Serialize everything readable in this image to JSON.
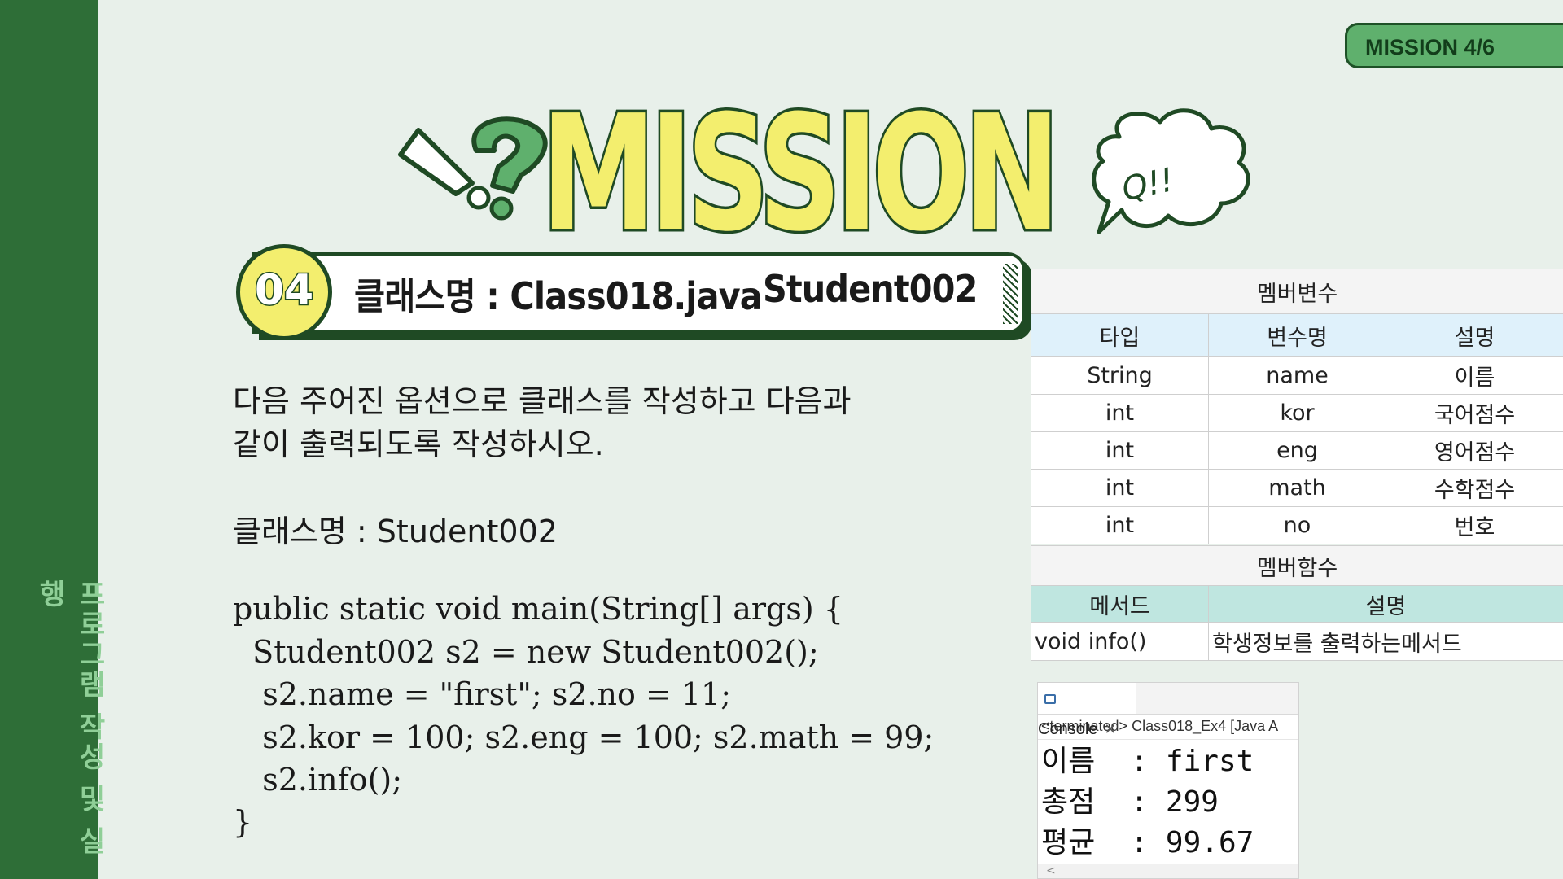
{
  "sidebar": {
    "label": "프로그램 작성 및 실행"
  },
  "badge": {
    "text": "MISSION 4/6"
  },
  "header": {
    "title": "MISSION",
    "bubble_text": "Q!!"
  },
  "task": {
    "number": "04",
    "class_label": "클래스명 : Class018.java",
    "class_label2": "Student002"
  },
  "description": {
    "line1": "다음 주어진 옵션으로 클래스를 작성하고 다음과",
    "line2": "같이 출력되도록 작성하시오.",
    "class_name": "클래스명 : Student002"
  },
  "code": {
    "lines": [
      "public static void main(String[] args) {",
      "  Student002 s2 = new Student002();",
      "   s2.name = \"first\"; s2.no = 11;",
      "   s2.kor = 100; s2.eng = 100; s2.math = 99;",
      "   s2.info();",
      "}"
    ]
  },
  "member_table": {
    "title": "멤버변수",
    "headers": [
      "타입",
      "변수명",
      "설명"
    ],
    "rows": [
      [
        "String",
        "name",
        "이름"
      ],
      [
        "int",
        "kor",
        "국어점수"
      ],
      [
        "int",
        "eng",
        "영어점수"
      ],
      [
        "int",
        "math",
        "수학점수"
      ],
      [
        "int",
        "no",
        "번호"
      ]
    ]
  },
  "function_table": {
    "title": "멤버함수",
    "headers": [
      "메서드",
      "설명"
    ],
    "rows": [
      [
        "void  info()",
        "학생정보를 출력하는메서드"
      ]
    ]
  },
  "console": {
    "tab_label": "Console",
    "close": "✕",
    "status": "<terminated> Class018_Ex4 [Java A",
    "lines": [
      "이름  : first",
      "총점  : 299",
      "평균  : 99.67"
    ],
    "scroll": "<"
  },
  "colors": {
    "sidebar": "#2e6e37",
    "background": "#e8f0ea",
    "accent_yellow": "#f3ee6e",
    "accent_green": "#5fb06d",
    "outline": "#1f4a24"
  },
  "icons": [
    "exclamation-icon",
    "question-mark-icon",
    "speech-bubble-icon",
    "console-icon",
    "close-icon"
  ]
}
